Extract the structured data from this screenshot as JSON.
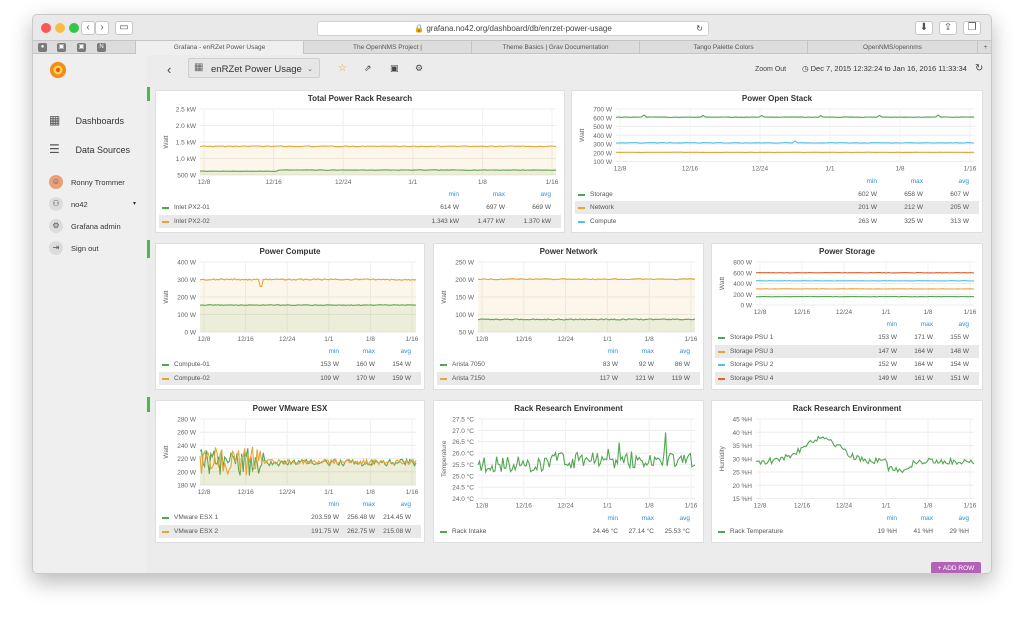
{
  "browser": {
    "url": "grafana.no42.org/dashboard/db/enrzet-power-usage",
    "tabs": [
      "Grafana - enRZet Power Usage",
      "The OpenNMS Project |",
      "Theme Basics | Grav Documentation",
      "Tango Palette Colors",
      "OpenNMS/opennms"
    ]
  },
  "sidebar": {
    "items": [
      {
        "label": "Dashboards",
        "icon": "grid-icon"
      },
      {
        "label": "Data Sources",
        "icon": "database-icon"
      }
    ],
    "user": "Ronny Trommer",
    "org": "no42",
    "admin": "Grafana admin",
    "signout": "Sign out"
  },
  "topbar": {
    "dashboard_title": "enRZet Power Usage",
    "zoom_out": "Zoom Out",
    "time_range": "Dec 7, 2015 12:32:24 to Jan 16, 2016 11:33:34"
  },
  "add_row": "+ ADD ROW",
  "colors": {
    "green": "#52a552",
    "orange": "#e8a436",
    "blue": "#56bfe0",
    "red": "#e5622f"
  },
  "panels": [
    {
      "title": "Total Power Rack Research",
      "chart_data": {
        "type": "line",
        "ylabel": "Watt",
        "y_ticks": [
          "2.5 kW",
          "2.0 kW",
          "1.5 kW",
          "1.0 kW",
          "500 W"
        ],
        "x_ticks": [
          "12/8",
          "12/16",
          "12/24",
          "1/1",
          "1/8",
          "1/16"
        ],
        "ylim": [
          500,
          2500
        ],
        "legend_headers": [
          "min",
          "max",
          "avg"
        ],
        "series": [
          {
            "name": "Inlet PX2-01",
            "color": "green",
            "level": 650,
            "start_level": 614,
            "step_at": 0.22,
            "noise": 8,
            "fill": true,
            "stats": [
              "614 W",
              "697 W",
              "669 W"
            ]
          },
          {
            "name": "Inlet PX2-02",
            "color": "orange",
            "level": 1370,
            "noise": 12,
            "fill": true,
            "stats": [
              "1.343 kW",
              "1.477 kW",
              "1.370 kW"
            ]
          }
        ]
      }
    },
    {
      "title": "Power Open Stack",
      "chart_data": {
        "type": "line",
        "ylabel": "Watt",
        "y_ticks": [
          "700 W",
          "600 W",
          "500 W",
          "400 W",
          "300 W",
          "200 W",
          "100 W"
        ],
        "x_ticks": [
          "12/8",
          "12/16",
          "12/24",
          "1/1",
          "1/8",
          "1/16"
        ],
        "ylim": [
          100,
          700
        ],
        "legend_headers": [
          "min",
          "max",
          "avg"
        ],
        "series": [
          {
            "name": "Storage",
            "color": "green",
            "level": 607,
            "noise": 3,
            "spikes": 6,
            "stats": [
              "602 W",
              "658 W",
              "607 W"
            ]
          },
          {
            "name": "Network",
            "color": "orange",
            "level": 205,
            "noise": 1,
            "stats": [
              "201 W",
              "212 W",
              "205 W"
            ]
          },
          {
            "name": "Compute",
            "color": "blue",
            "level": 313,
            "noise": 3,
            "spikes": 1,
            "stats": [
              "263 W",
              "325 W",
              "313 W"
            ]
          }
        ]
      }
    },
    {
      "title": "Power Compute",
      "chart_data": {
        "type": "line",
        "ylabel": "Watt",
        "y_ticks": [
          "400 W",
          "300 W",
          "200 W",
          "100 W",
          "0 W"
        ],
        "x_ticks": [
          "12/8",
          "12/16",
          "12/24",
          "1/1",
          "1/8",
          "1/16"
        ],
        "ylim": [
          0,
          400
        ],
        "legend_headers": [
          "min",
          "max",
          "avg"
        ],
        "series": [
          {
            "name": "Compute-01",
            "color": "green",
            "level": 154,
            "noise": 2,
            "fill": true,
            "stats": [
              "153 W",
              "160 W",
              "154 W"
            ]
          },
          {
            "name": "Compute-02",
            "color": "orange",
            "level": 300,
            "noise": 4,
            "fill": true,
            "dip": 0.28,
            "stats": [
              "109 W",
              "170 W",
              "159 W"
            ]
          }
        ]
      }
    },
    {
      "title": "Power Network",
      "chart_data": {
        "type": "line",
        "ylabel": "Watt",
        "y_ticks": [
          "250 W",
          "200 W",
          "150 W",
          "100 W",
          "50 W"
        ],
        "x_ticks": [
          "12/8",
          "12/16",
          "12/24",
          "1/1",
          "1/8",
          "1/16"
        ],
        "ylim": [
          50,
          250
        ],
        "legend_headers": [
          "min",
          "max",
          "avg"
        ],
        "series": [
          {
            "name": "Arista 7050",
            "color": "green",
            "level": 86,
            "noise": 1.5,
            "fill": true,
            "stats": [
              "83 W",
              "92 W",
              "86 W"
            ]
          },
          {
            "name": "Arista 7150",
            "color": "orange",
            "level": 201,
            "noise": 1.5,
            "fill": true,
            "stats": [
              "117 W",
              "121 W",
              "119 W"
            ]
          }
        ]
      }
    },
    {
      "title": "Power Storage",
      "chart_data": {
        "type": "line",
        "ylabel": "Watt",
        "y_ticks": [
          "800 W",
          "600 W",
          "400 W",
          "200 W",
          "0 W"
        ],
        "x_ticks": [
          "12/8",
          "12/16",
          "12/24",
          "1/1",
          "1/8",
          "1/16"
        ],
        "ylim": [
          0,
          800
        ],
        "legend_headers": [
          "min",
          "max",
          "avg"
        ],
        "series": [
          {
            "name": "Storage PSU 1",
            "color": "green",
            "level": 155,
            "noise": 3,
            "stats": [
              "153 W",
              "171 W",
              "155 W"
            ]
          },
          {
            "name": "Storage PSU 3",
            "color": "orange",
            "level": 300,
            "noise": 3,
            "stats": [
              "147 W",
              "164 W",
              "148 W"
            ]
          },
          {
            "name": "Storage PSU 2",
            "color": "blue",
            "level": 450,
            "noise": 3,
            "stats": [
              "152 W",
              "164 W",
              "154 W"
            ]
          },
          {
            "name": "Storage PSU 4",
            "color": "red",
            "level": 600,
            "noise": 4,
            "stats": [
              "149 W",
              "161 W",
              "151 W"
            ]
          }
        ]
      }
    },
    {
      "title": "Power VMware ESX",
      "chart_data": {
        "type": "line",
        "ylabel": "Watt",
        "y_ticks": [
          "280 W",
          "260 W",
          "240 W",
          "220 W",
          "200 W",
          "180 W"
        ],
        "x_ticks": [
          "12/8",
          "12/16",
          "12/24",
          "1/1",
          "1/8",
          "1/16"
        ],
        "ylim": [
          180,
          280
        ],
        "legend_headers": [
          "min",
          "max",
          "avg"
        ],
        "series": [
          {
            "name": "VMware ESX 1",
            "color": "green",
            "level": 214,
            "noise": 5,
            "volatile_until": 0.3,
            "fill": true,
            "stats": [
              "203.59 W",
              "256.48 W",
              "214.45 W"
            ]
          },
          {
            "name": "VMware ESX 2",
            "color": "orange",
            "level": 215,
            "noise": 4,
            "volatile_until": 0.28,
            "fill": true,
            "stats": [
              "191.75 W",
              "262.75 W",
              "215.08 W"
            ]
          }
        ]
      }
    },
    {
      "title": "Rack Research Environment",
      "chart_data": {
        "type": "line",
        "ylabel": "Temperature",
        "y_ticks": [
          "27.5 °C",
          "27.0 °C",
          "26.5 °C",
          "26.0 °C",
          "25.5 °C",
          "25.0 °C",
          "24.5 °C",
          "24.0 °C"
        ],
        "x_ticks": [
          "12/8",
          "12/16",
          "12/24",
          "1/1",
          "1/8",
          "1/16"
        ],
        "ylim": [
          24,
          27.5
        ],
        "legend_headers": [
          "min",
          "max",
          "avg"
        ],
        "series": [
          {
            "name": "Rack Intake",
            "color": "green",
            "level": 25.5,
            "noise": 0.35,
            "rise": 0.3,
            "stats": [
              "24.46 °C",
              "27.14 °C",
              "25.53 °C"
            ]
          }
        ]
      }
    },
    {
      "title": "Rack Research Environment",
      "chart_data": {
        "type": "line",
        "ylabel": "Humidity",
        "y_ticks": [
          "45 %H",
          "40 %H",
          "35 %H",
          "30 %H",
          "25 %H",
          "20 %H",
          "15 %H"
        ],
        "x_ticks": [
          "12/8",
          "12/16",
          "12/24",
          "1/1",
          "1/8",
          "1/16"
        ],
        "ylim": [
          15,
          45
        ],
        "legend_headers": [
          "min",
          "max",
          "avg"
        ],
        "series": [
          {
            "name": "Rack Temperature",
            "color": "green",
            "level": 29,
            "noise": 1.2,
            "hump": 0.3,
            "stats": [
              "19 %H",
              "41 %H",
              "29 %H"
            ]
          }
        ]
      }
    }
  ]
}
